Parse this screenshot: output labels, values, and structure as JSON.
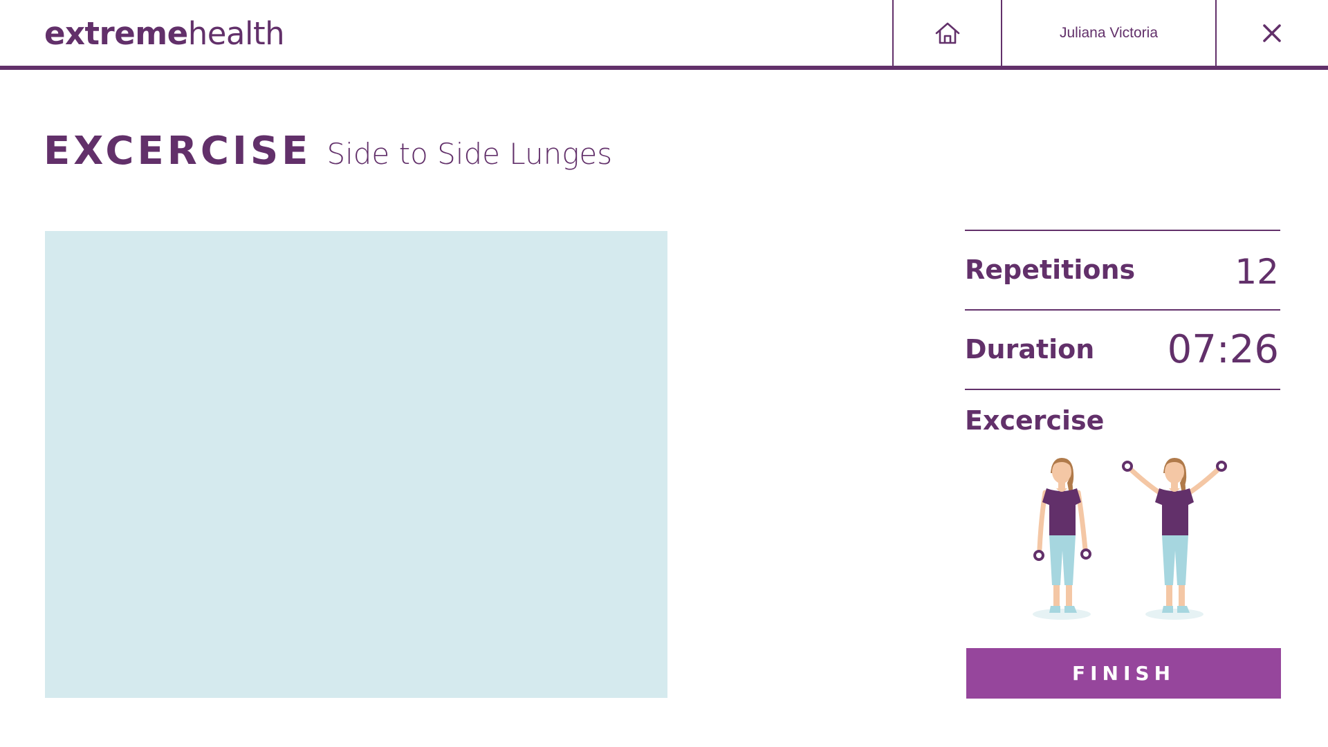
{
  "header": {
    "logo_bold": "extreme",
    "logo_light": "health",
    "home_icon": "home-icon",
    "user_name": "Juliana Victoria",
    "close_icon": "close-icon"
  },
  "exercise": {
    "heading": "EXCERCISE",
    "name": "Side to Side Lunges"
  },
  "stats": {
    "repetitions_label": "Repetitions",
    "repetitions_value": "12",
    "duration_label": "Duration",
    "duration_value": "07:26",
    "exercise_label": "Excercise"
  },
  "actions": {
    "finish_label": "FINISH"
  },
  "colors": {
    "primary": "#62306a",
    "button": "#96469c",
    "video_bg": "#d5eaee"
  }
}
